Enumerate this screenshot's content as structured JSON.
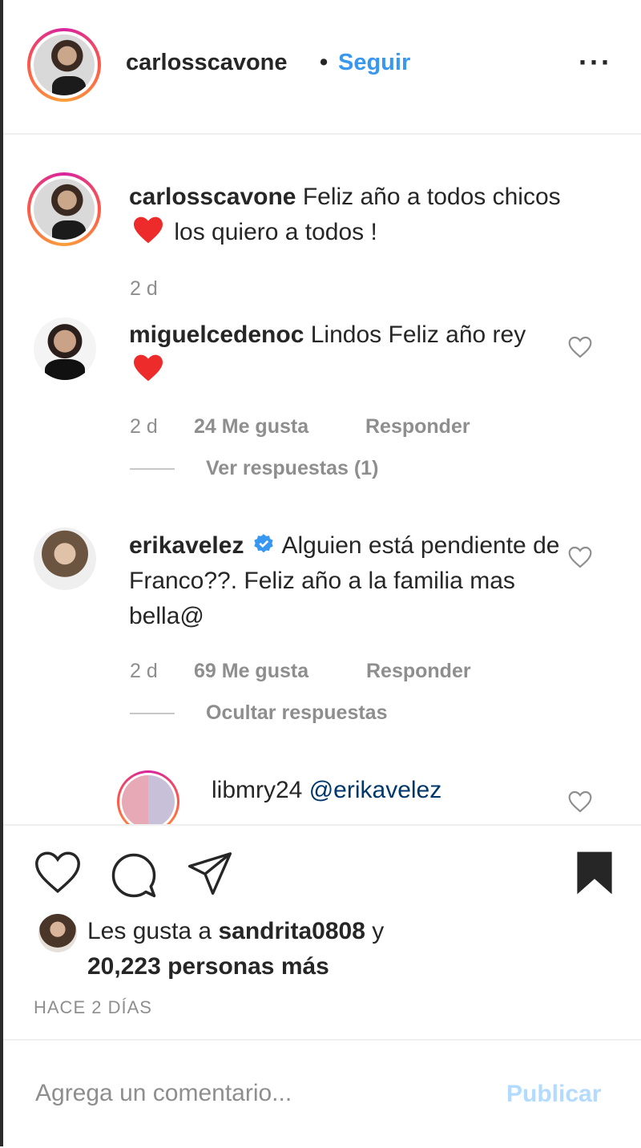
{
  "header": {
    "username": "carlosscavone",
    "separator": "•",
    "follow_label": "Seguir",
    "more_icon": "more-horizontal-icon",
    "more_glyph": "···"
  },
  "caption": {
    "username": "carlosscavone",
    "text_part1": "Feliz año a todos chicos",
    "text_part2": "los quiero a todos !",
    "age": "2 d"
  },
  "comments": [
    {
      "username": "miguelcedenoc",
      "text_part1": "Lindos Feliz año rey",
      "age": "2 d",
      "likes": "24 Me gusta",
      "reply_label": "Responder",
      "replies_toggle": "Ver respuestas (1)"
    },
    {
      "username": "erikavelez",
      "verified": true,
      "text": "Alguien está pendiente de Franco??. Feliz año a la familia mas bella@",
      "age": "2 d",
      "likes": "69 Me gusta",
      "reply_label": "Responder",
      "replies_toggle": "Ocultar respuestas"
    }
  ],
  "reply": {
    "username": "libmry24",
    "mention": "@erikavelez"
  },
  "actions": {
    "like_icon": "heart-icon",
    "comment_icon": "comment-icon",
    "share_icon": "paper-plane-icon",
    "save_icon": "bookmark-icon"
  },
  "likes": {
    "prefix": "Les gusta a",
    "user": "sandrita0808",
    "joiner": "y",
    "count_text": "20,223 personas más"
  },
  "timestamp": "HACE 2 DÍAS",
  "add_comment": {
    "placeholder": "Agrega un comentario...",
    "publish_label": "Publicar"
  },
  "colors": {
    "accent": "#3897f0",
    "publish_disabled": "#b3dbff",
    "heart_red": "#ed4956",
    "muted": "#8e8e8e"
  }
}
